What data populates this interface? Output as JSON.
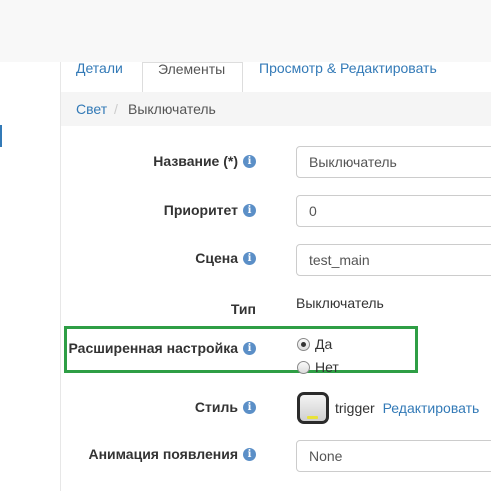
{
  "tabs": [
    {
      "label": "Детали"
    },
    {
      "label": "Элементы"
    },
    {
      "label": "Просмотр & Редактировать"
    }
  ],
  "breadcrumb": {
    "parent": "Свет",
    "separator": "/",
    "current": "Выключатель"
  },
  "form": {
    "name": {
      "label": "Название (*)",
      "value": "Выключатель"
    },
    "priority": {
      "label": "Приоритет",
      "value": "0"
    },
    "scene": {
      "label": "Сцена",
      "value": "test_main"
    },
    "type": {
      "label": "Тип",
      "value": "Выключатель"
    },
    "advanced": {
      "label": "Расширенная настройка",
      "options": [
        {
          "label": "Да",
          "checked": true
        },
        {
          "label": "Нет",
          "checked": false
        }
      ]
    },
    "style": {
      "label": "Стиль",
      "value": "trigger",
      "edit_label": "Редактировать"
    },
    "animation": {
      "label": "Анимация появления",
      "value": "None"
    }
  },
  "icons": {
    "info": "i"
  },
  "colors": {
    "link": "#337ab7",
    "highlight_box": "#2e9e45",
    "info_icon": "#5b8fc7"
  }
}
